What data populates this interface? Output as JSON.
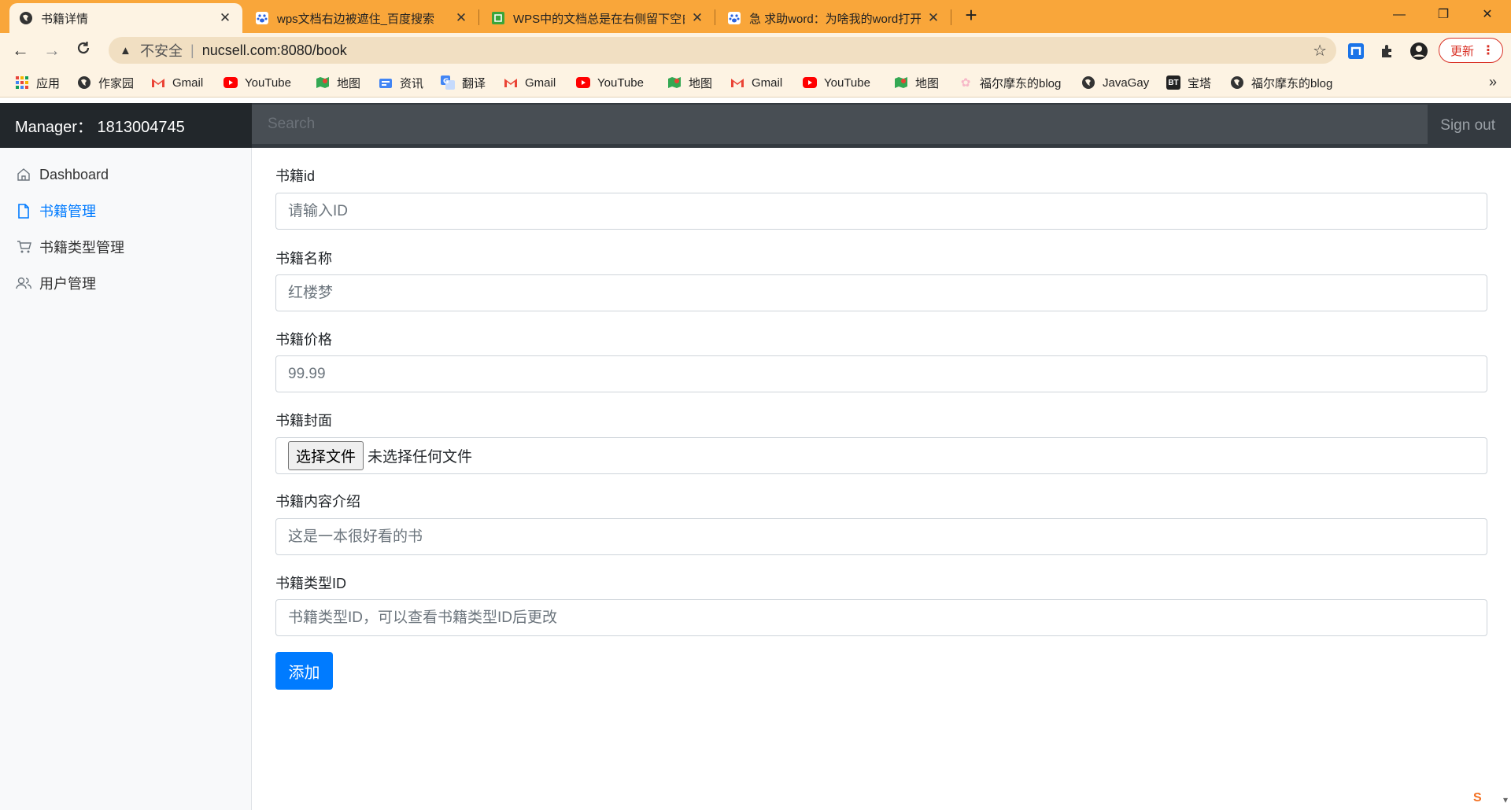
{
  "browser": {
    "tabs": [
      {
        "title": "书籍详情",
        "active": true,
        "icon": "globe-icon"
      },
      {
        "title": "wps文档右边被遮住_百度搜索",
        "active": false,
        "icon": "baidu-paw-icon"
      },
      {
        "title": "WPS中的文档总是在右侧留下空白",
        "active": false,
        "icon": "green-app-icon"
      },
      {
        "title": "急 求助word：为啥我的word打开",
        "active": false,
        "icon": "baidu-paw-icon"
      }
    ],
    "address": {
      "security_label": "不安全",
      "url": "nucsell.com:8080/book"
    },
    "update_label": "更新",
    "bookmarks": [
      {
        "label": "应用",
        "icon": "apps-grid-icon"
      },
      {
        "label": "作家园",
        "icon": "globe-icon"
      },
      {
        "label": "Gmail",
        "icon": "gmail-icon"
      },
      {
        "label": "YouTube",
        "icon": "youtube-icon"
      },
      {
        "label": "地图",
        "icon": "maps-icon"
      },
      {
        "label": "资讯",
        "icon": "news-icon"
      },
      {
        "label": "翻译",
        "icon": "translate-icon"
      },
      {
        "label": "Gmail",
        "icon": "gmail-icon"
      },
      {
        "label": "YouTube",
        "icon": "youtube-icon"
      },
      {
        "label": "地图",
        "icon": "maps-icon"
      },
      {
        "label": "Gmail",
        "icon": "gmail-icon"
      },
      {
        "label": "YouTube",
        "icon": "youtube-icon"
      },
      {
        "label": "地图",
        "icon": "maps-icon"
      },
      {
        "label": "福尔摩东的blog",
        "icon": "flower-icon"
      },
      {
        "label": "JavaGay",
        "icon": "globe-icon"
      },
      {
        "label": "宝塔",
        "icon": "bt-icon"
      },
      {
        "label": "福尔摩东的blog",
        "icon": "globe-icon"
      }
    ],
    "colors": {
      "tabbar": "#f9a63a",
      "toolbar": "#fdf3e3"
    }
  },
  "app": {
    "brand": "Manager：  1813004745",
    "search_placeholder": "Search",
    "signout": "Sign out",
    "sidebar": [
      {
        "label": "Dashboard",
        "icon": "home-icon",
        "active": false
      },
      {
        "label": "书籍管理",
        "icon": "file-icon",
        "active": true
      },
      {
        "label": "书籍类型管理",
        "icon": "cart-icon",
        "active": false
      },
      {
        "label": "用户管理",
        "icon": "users-icon",
        "active": false
      }
    ],
    "form": {
      "id": {
        "label": "书籍id",
        "placeholder": "请输入ID"
      },
      "name": {
        "label": "书籍名称",
        "placeholder": "红楼梦"
      },
      "price": {
        "label": "书籍价格",
        "placeholder": "99.99"
      },
      "cover": {
        "label": "书籍封面",
        "button": "选择文件",
        "status": "未选择任何文件"
      },
      "intro": {
        "label": "书籍内容介绍",
        "placeholder": "这是一本很好看的书"
      },
      "type_id": {
        "label": "书籍类型ID",
        "placeholder": "书籍类型ID，可以查看书籍类型ID后更改"
      },
      "submit": "添加"
    },
    "colors": {
      "primary": "#007bff",
      "navbar": "#343a40",
      "brand_bg": "#22272b"
    }
  }
}
